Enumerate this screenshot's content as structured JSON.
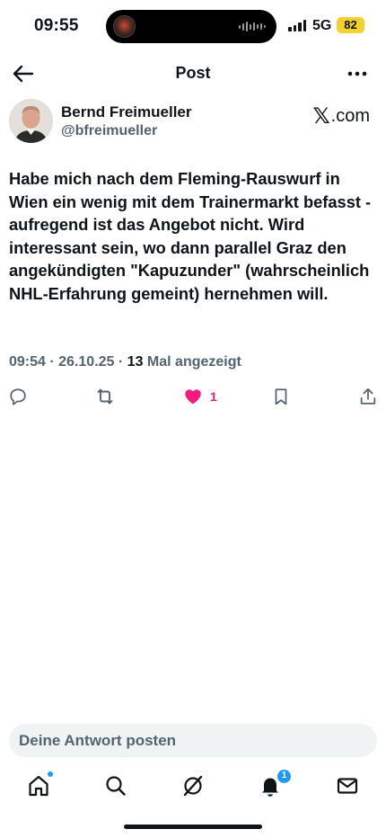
{
  "status_bar": {
    "time": "09:55",
    "network": "5G",
    "battery": "82",
    "battery_color": "#f5d130"
  },
  "header": {
    "title": "Post",
    "back_icon": "arrow-left-icon",
    "more_icon": "more-horizontal-icon"
  },
  "author": {
    "name": "Bernd Freimueller",
    "handle": "@bfreimueller",
    "platform_x": "𝕏",
    "platform_domain": ".com"
  },
  "post": {
    "text": "Habe mich nach dem Fleming-Rauswurf in Wien ein wenig mit dem Trainermarkt befasst - aufregend ist das Angebot nicht. Wird interessant sein, wo dann parallel Graz den angekündigten \"Kapuzunder\" (wahrscheinlich NHL-Erfahrung gemeint) hernehmen will.",
    "time": "09:54",
    "date": "26.10.25",
    "separator": "·",
    "views_count": "13",
    "views_label": "Mal angezeigt"
  },
  "actions": {
    "reply_icon": "reply-icon",
    "repost_icon": "repost-icon",
    "like_icon": "heart-filled-icon",
    "like_count": "1",
    "like_color": "#f91880",
    "bookmark_icon": "bookmark-icon",
    "share_icon": "share-icon"
  },
  "reply_box": {
    "placeholder": "Deine Antwort posten"
  },
  "tabbar": {
    "home_icon": "home-icon",
    "search_icon": "search-icon",
    "grok_icon": "grok-icon",
    "notifications_icon": "bell-icon",
    "notifications_badge": "1",
    "messages_icon": "mail-icon",
    "accent_color": "#1d9bf0"
  }
}
